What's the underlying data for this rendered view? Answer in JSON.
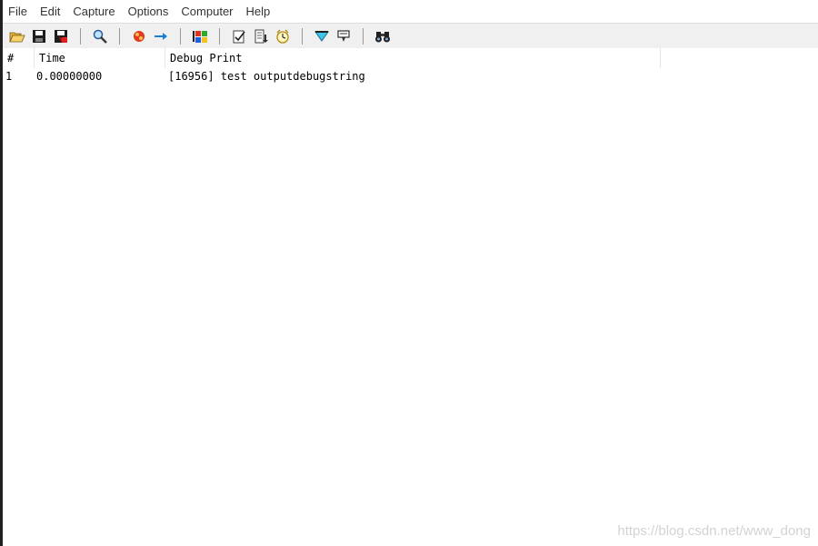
{
  "menu": {
    "items": [
      "File",
      "Edit",
      "Capture",
      "Options",
      "Computer",
      "Help"
    ]
  },
  "toolbar": {
    "icons": [
      "open-folder-icon",
      "save-icon",
      "save-as-icon",
      "find-icon",
      "capture-icon",
      "autoscroll-icon",
      "filter-icon",
      "clear-icon",
      "log-to-file-icon",
      "clock-icon",
      "highlight-icon",
      "history-icon",
      "binoculars-icon"
    ]
  },
  "list": {
    "columns": [
      "#",
      "Time",
      "Debug Print"
    ],
    "rows": [
      {
        "num": "1",
        "time": "0.00000000",
        "text": "[16956] test outputdebugstring"
      }
    ]
  },
  "watermark": "https://blog.csdn.net/www_dong",
  "colors": {
    "toolbar_bg": "#f0f0f0",
    "left_edge": "#202020"
  }
}
